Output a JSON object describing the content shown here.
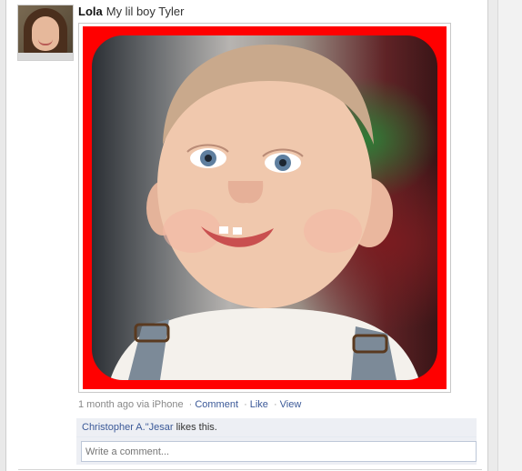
{
  "post": {
    "author_name": "Lola",
    "message": "My lil boy Tyler",
    "timestamp": "1 month ago",
    "via": "via iPhone",
    "actions": {
      "comment": "Comment",
      "like": "Like",
      "view": "View"
    }
  },
  "likes": {
    "liker": "Christopher A.\"Jesar",
    "suffix": "likes this."
  },
  "comment_box": {
    "placeholder": "Write a comment..."
  },
  "colors": {
    "link": "#3b5998",
    "photo_border": "#ff0000",
    "feedback_bg": "#edeff4"
  }
}
